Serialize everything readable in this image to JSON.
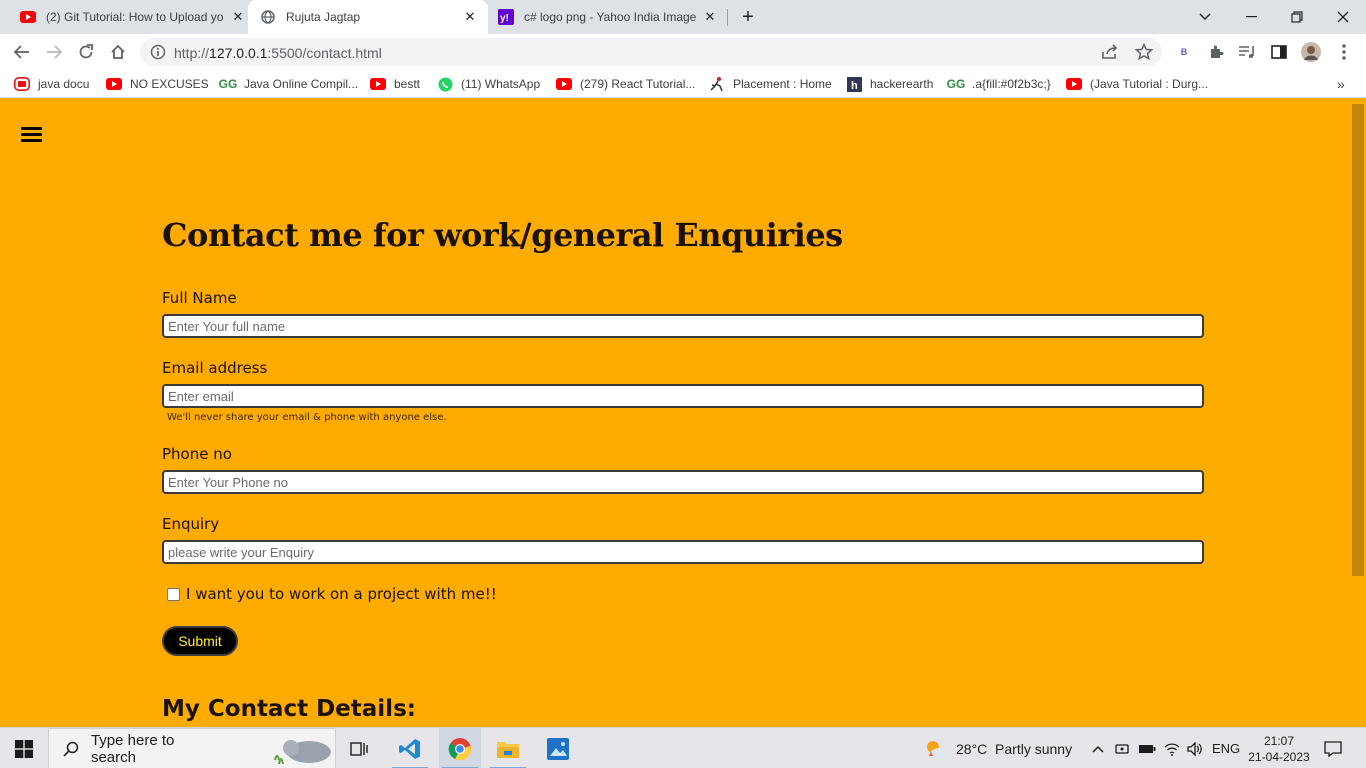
{
  "tabs": [
    {
      "title": "(2) Git Tutorial: How to Upload yo",
      "icon": "youtube-icon"
    },
    {
      "title": "Rujuta Jagtap",
      "icon": "globe-icon"
    },
    {
      "title": "c# logo png - Yahoo India Image",
      "icon": "yahoo-icon"
    }
  ],
  "address": {
    "url_prefix": "http://",
    "url_host": "127.0.0.1",
    "url_path": ":5500/contact.html"
  },
  "bookmarks": [
    {
      "label": "java docu",
      "icon": "java-docu-icon"
    },
    {
      "label": "NO EXCUSES",
      "icon": "youtube-icon"
    },
    {
      "label": "Java Online Compil...",
      "icon": "geeksforgeeks-icon"
    },
    {
      "label": "bestt",
      "icon": "youtube-icon"
    },
    {
      "label": "(11) WhatsApp",
      "icon": "whatsapp-icon"
    },
    {
      "label": "(279) React Tutorial...",
      "icon": "youtube-icon"
    },
    {
      "label": "Placement : Home",
      "icon": "placement-icon"
    },
    {
      "label": "hackerearth",
      "icon": "hackerearth-icon"
    },
    {
      "label": ".a{fill:#0f2b3c;}",
      "icon": "geeksforgeeks-icon"
    },
    {
      "label": "(Java Tutorial : Durg...",
      "icon": "youtube-icon"
    }
  ],
  "profile_badge": "B",
  "page": {
    "heading": "Contact me for work/general Enquiries",
    "fields": {
      "name": {
        "label": "Full Name",
        "placeholder": "Enter Your full name"
      },
      "email": {
        "label": "Email address",
        "placeholder": "Enter email",
        "help": "We'll never share your email & phone with anyone else."
      },
      "phone": {
        "label": "Phone no",
        "placeholder": "Enter Your Phone no"
      },
      "enquiry": {
        "label": "Enquiry",
        "placeholder": "please write your Enquiry"
      }
    },
    "checkbox_label": "I want you to work on a project with me!!",
    "submit_label": "Submit",
    "contact_heading": "My Contact Details:"
  },
  "taskbar": {
    "search_placeholder": "Type here to search",
    "weather": "28°C  Partly sunny",
    "language": "ENG",
    "time": "21:07",
    "date": "21-04-2023"
  },
  "colors": {
    "page_bg": "#ffab00",
    "submit_text": "#ffeb3b"
  }
}
